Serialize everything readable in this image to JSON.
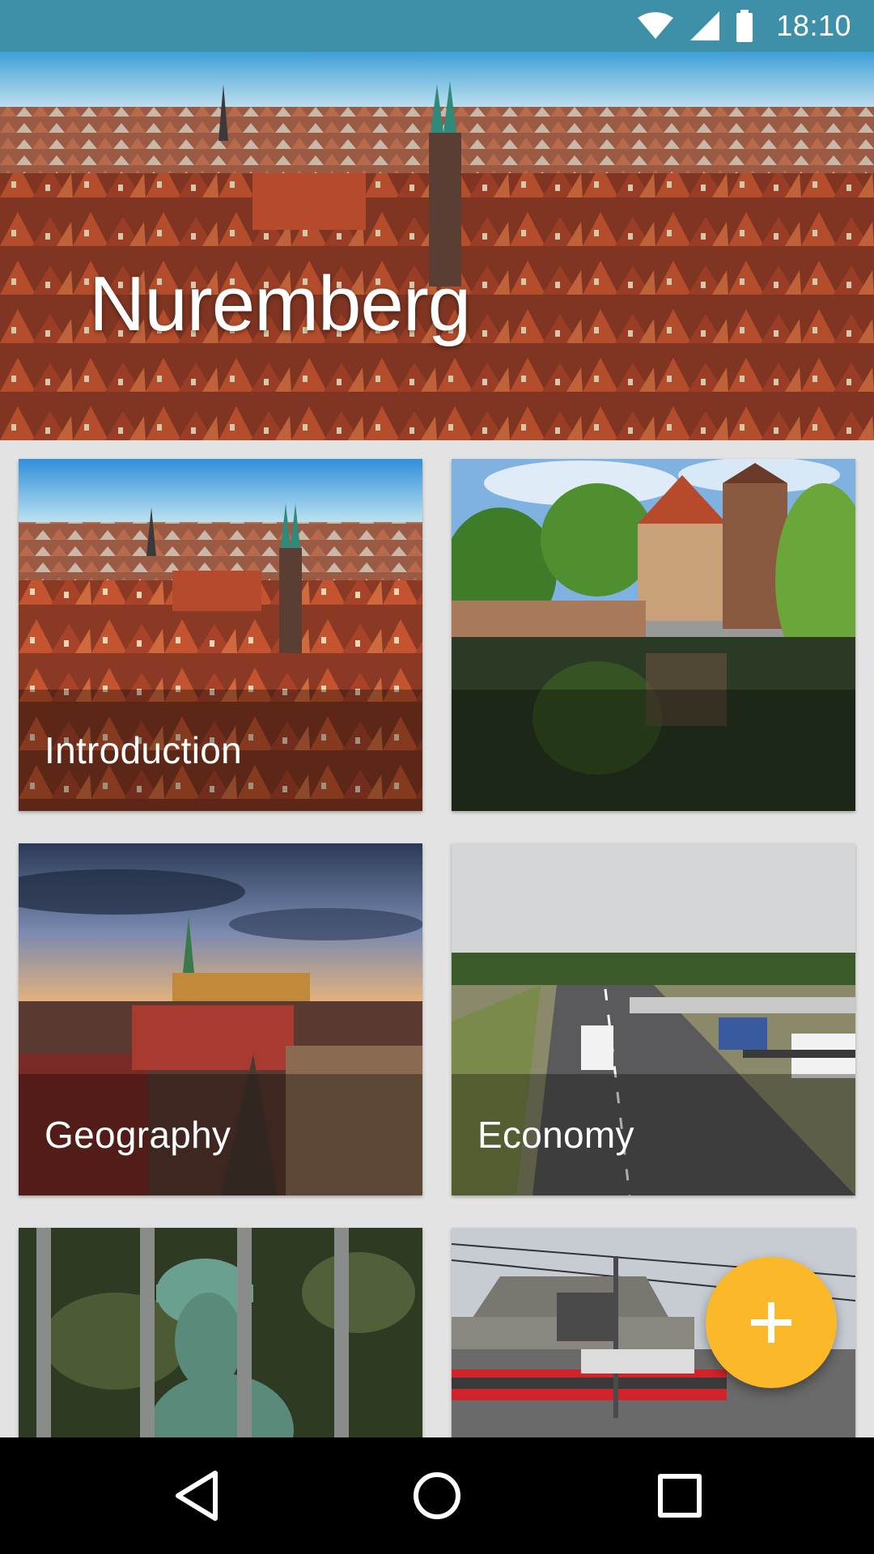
{
  "status_bar": {
    "time": "18:10",
    "icons": [
      "wifi-icon",
      "cell-signal-icon",
      "battery-icon"
    ]
  },
  "header": {
    "title": "Nuremberg",
    "image": "city-rooftops-panorama"
  },
  "cards": [
    {
      "label": "Introduction",
      "image": "city-skyline"
    },
    {
      "label": "",
      "image": "riverside-tower-house"
    },
    {
      "label": "Geography",
      "image": "castle-at-dusk"
    },
    {
      "label": "Economy",
      "image": "highway-trucks"
    },
    {
      "label": "",
      "image": "statue-behind-fence"
    },
    {
      "label": "",
      "image": "train-station"
    }
  ],
  "fab": {
    "icon": "plus-icon"
  },
  "nav_bar": {
    "buttons": [
      "back-icon",
      "home-icon",
      "recents-icon"
    ]
  },
  "colors": {
    "status_bar": "#3e8fa8",
    "background": "#e3e3e3",
    "fab": "#fbb829",
    "nav_bar": "#000000",
    "roof_red": "#b84a2c"
  }
}
